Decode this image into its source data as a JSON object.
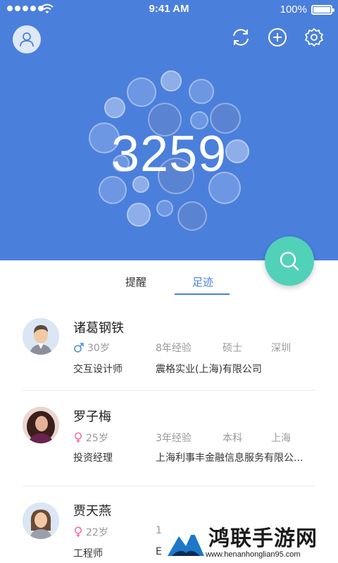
{
  "status_bar": {
    "time": "9:41 AM",
    "battery": "100%"
  },
  "header": {
    "count": "3259"
  },
  "tabs": [
    {
      "label": "提醒",
      "active": false
    },
    {
      "label": "足迹",
      "active": true
    }
  ],
  "people": [
    {
      "name": "诸葛钢铁",
      "gender": "male",
      "age": "30岁",
      "experience": "8年经验",
      "degree": "硕士",
      "city": "深圳",
      "title": "交互设计师",
      "company": "震格实业(上海)有限公司"
    },
    {
      "name": "罗子梅",
      "gender": "female",
      "age": "25岁",
      "experience": "3年经验",
      "degree": "本科",
      "city": "上海",
      "title": "投资经理",
      "company": "上海利事丰金融信息服务有限公..."
    },
    {
      "name": "贾天燕",
      "gender": "female",
      "age": "22岁",
      "experience": "1",
      "title": "工程师",
      "company": "E"
    }
  ],
  "watermark": {
    "title": "鸿联手游网",
    "url": "www.henanhonglian95.com"
  },
  "colors": {
    "header_blue": "#4a7fdc",
    "fab_teal": "#52d1b9",
    "male_blue": "#4a90e2",
    "female_pink": "#f06fa8"
  },
  "icons": [
    "user-icon",
    "refresh-icon",
    "plus-icon",
    "gear-icon",
    "search-icon",
    "male-icon",
    "female-icon"
  ]
}
